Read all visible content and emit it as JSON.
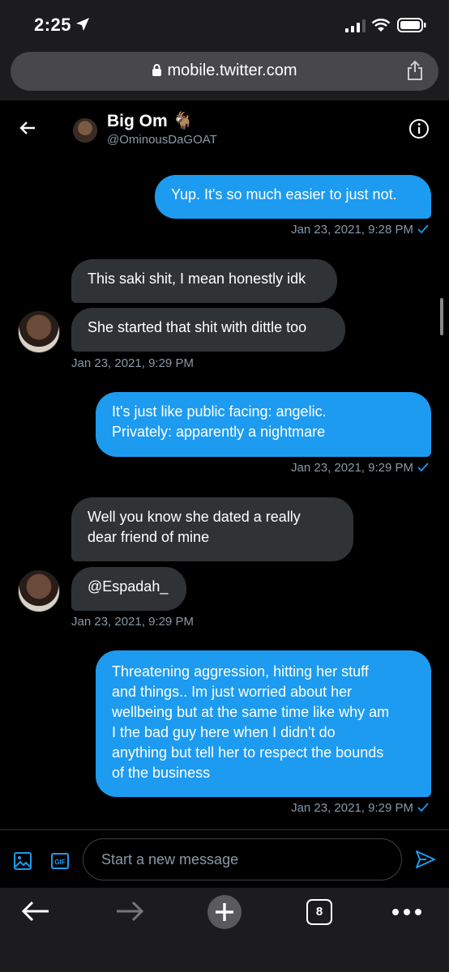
{
  "status": {
    "time": "2:25"
  },
  "browser": {
    "url": "mobile.twitter.com",
    "tab_count": "8"
  },
  "header": {
    "name": "Big Om 🐐",
    "handle": "@OminousDaGOAT"
  },
  "messages": [
    {
      "dir": "sent",
      "text": "Yup. It's so much easier to just not."
    },
    {
      "dir": "ts",
      "text": "Jan 23, 2021, 9:28 PM"
    },
    {
      "dir": "recv",
      "text": "This saki shit, I mean honestly idk"
    },
    {
      "dir": "recv",
      "text": "She started that shit with dittle too"
    },
    {
      "dir": "ts",
      "text": "Jan 23, 2021, 9:29 PM"
    },
    {
      "dir": "sent",
      "text": "It's just like public facing: angelic.\nPrivately: apparently a nightmare"
    },
    {
      "dir": "ts",
      "text": "Jan 23, 2021, 9:29 PM"
    },
    {
      "dir": "recv",
      "text": "Well you know she dated a really\ndear friend of mine"
    },
    {
      "dir": "recv",
      "text": "@Espadah_"
    },
    {
      "dir": "ts",
      "text": "Jan 23, 2021, 9:29 PM"
    },
    {
      "dir": "sent",
      "text": "Threatening aggression, hitting her stuff\nand things.. Im just worried about her\nwellbeing but at the same time like why am\nI the bad guy here when I didn't do\nanything but tell her to respect the bounds\nof the business"
    },
    {
      "dir": "ts",
      "text": "Jan 23, 2021, 9:29 PM"
    }
  ],
  "composer": {
    "placeholder": "Start a new message"
  },
  "colors": {
    "accent": "#1d9bf0",
    "received": "#2f3336",
    "muted": "#8899a6"
  }
}
